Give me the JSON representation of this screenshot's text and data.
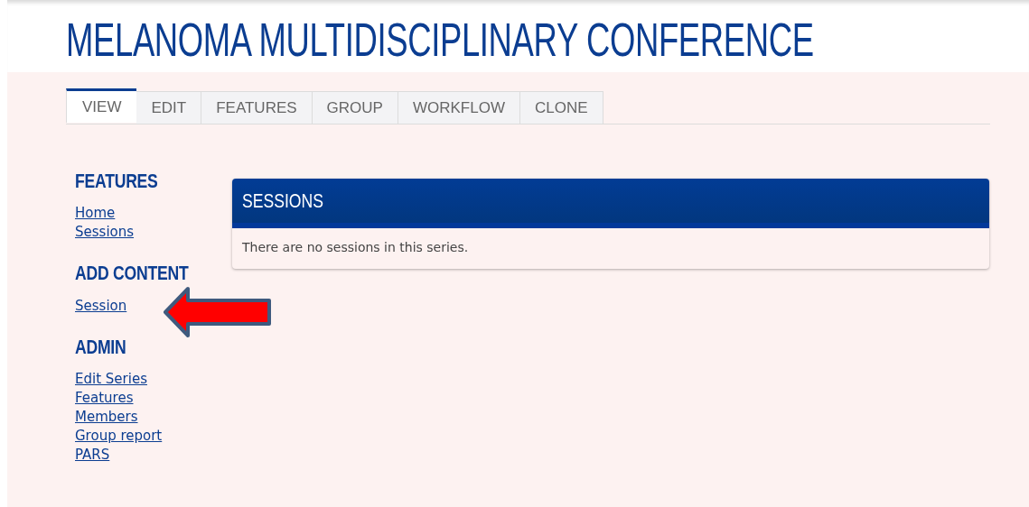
{
  "title": "MELANOMA MULTIDISCIPLINARY CONFERENCE",
  "tabs": [
    {
      "label": "VIEW",
      "selected": true
    },
    {
      "label": "EDIT",
      "selected": false
    },
    {
      "label": "FEATURES",
      "selected": false
    },
    {
      "label": "GROUP",
      "selected": false
    },
    {
      "label": "WORKFLOW",
      "selected": false
    },
    {
      "label": "CLONE",
      "selected": false
    }
  ],
  "sidebar": [
    {
      "heading": "FEATURES",
      "links": [
        "Home",
        "Sessions"
      ]
    },
    {
      "heading": "ADD CONTENT",
      "links": [
        "Session"
      ]
    },
    {
      "heading": "ADMIN",
      "links": [
        "Edit Series",
        "Features",
        "Members",
        "Group report",
        "PARS"
      ]
    }
  ],
  "panel": {
    "title": "SESSIONS",
    "message": "There are no sessions in this series."
  }
}
